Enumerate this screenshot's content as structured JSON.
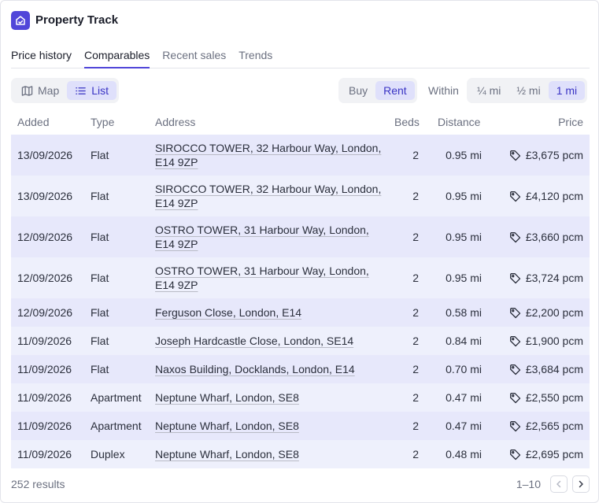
{
  "app": {
    "title": "Property Track"
  },
  "tabs": [
    {
      "label": "Price history"
    },
    {
      "label": "Comparables"
    },
    {
      "label": "Recent sales"
    },
    {
      "label": "Trends"
    }
  ],
  "view_toggle": {
    "map_label": "Map",
    "list_label": "List",
    "selected": "List"
  },
  "mode_toggle": {
    "buy_label": "Buy",
    "rent_label": "Rent",
    "selected": "Rent"
  },
  "radius": {
    "within_label": "Within",
    "options": [
      "¼ mi",
      "½ mi",
      "1 mi"
    ],
    "selected": "1 mi"
  },
  "table": {
    "columns": [
      "Added",
      "Type",
      "Address",
      "Beds",
      "Distance",
      "Price"
    ],
    "rows": [
      {
        "added": "13/09/2026",
        "type": "Flat",
        "address": "SIROCCO TOWER, 32 Harbour Way, London, E14 9ZP",
        "beds": "2",
        "distance": "0.95 mi",
        "price": "£3,675 pcm"
      },
      {
        "added": "13/09/2026",
        "type": "Flat",
        "address": "SIROCCO TOWER, 32 Harbour Way, London, E14 9ZP",
        "beds": "2",
        "distance": "0.95 mi",
        "price": "£4,120 pcm"
      },
      {
        "added": "12/09/2026",
        "type": "Flat",
        "address": "OSTRO TOWER, 31 Harbour Way, London, E14 9ZP",
        "beds": "2",
        "distance": "0.95 mi",
        "price": "£3,660 pcm"
      },
      {
        "added": "12/09/2026",
        "type": "Flat",
        "address": "OSTRO TOWER, 31 Harbour Way, London, E14 9ZP",
        "beds": "2",
        "distance": "0.95 mi",
        "price": "£3,724 pcm"
      },
      {
        "added": "12/09/2026",
        "type": "Flat",
        "address": "Ferguson Close, London, E14",
        "beds": "2",
        "distance": "0.58 mi",
        "price": "£2,200 pcm"
      },
      {
        "added": "11/09/2026",
        "type": "Flat",
        "address": "Joseph Hardcastle Close, London, SE14",
        "beds": "2",
        "distance": "0.84 mi",
        "price": "£1,900 pcm"
      },
      {
        "added": "11/09/2026",
        "type": "Flat",
        "address": "Naxos Building, Docklands, London, E14",
        "beds": "2",
        "distance": "0.70 mi",
        "price": "£3,684 pcm"
      },
      {
        "added": "11/09/2026",
        "type": "Apartment",
        "address": "Neptune Wharf, London, SE8",
        "beds": "2",
        "distance": "0.47 mi",
        "price": "£2,550 pcm"
      },
      {
        "added": "11/09/2026",
        "type": "Apartment",
        "address": "Neptune Wharf, London, SE8",
        "beds": "2",
        "distance": "0.47 mi",
        "price": "£2,565 pcm"
      },
      {
        "added": "11/09/2026",
        "type": "Duplex",
        "address": "Neptune Wharf, London, SE8",
        "beds": "2",
        "distance": "0.48 mi",
        "price": "£2,695 pcm"
      }
    ]
  },
  "footer": {
    "results": "252 results",
    "range": "1–10"
  },
  "icons": {
    "logo": "home-icon",
    "map": "map-icon",
    "list": "list-icon",
    "price": "tag-icon",
    "prev": "chevron-left-icon",
    "next": "chevron-right-icon"
  },
  "colors": {
    "accent": "#5046d9",
    "row_odd": "#e7e8fb",
    "row_even": "#eef0fc",
    "selected_bg": "#dfe0fb"
  }
}
